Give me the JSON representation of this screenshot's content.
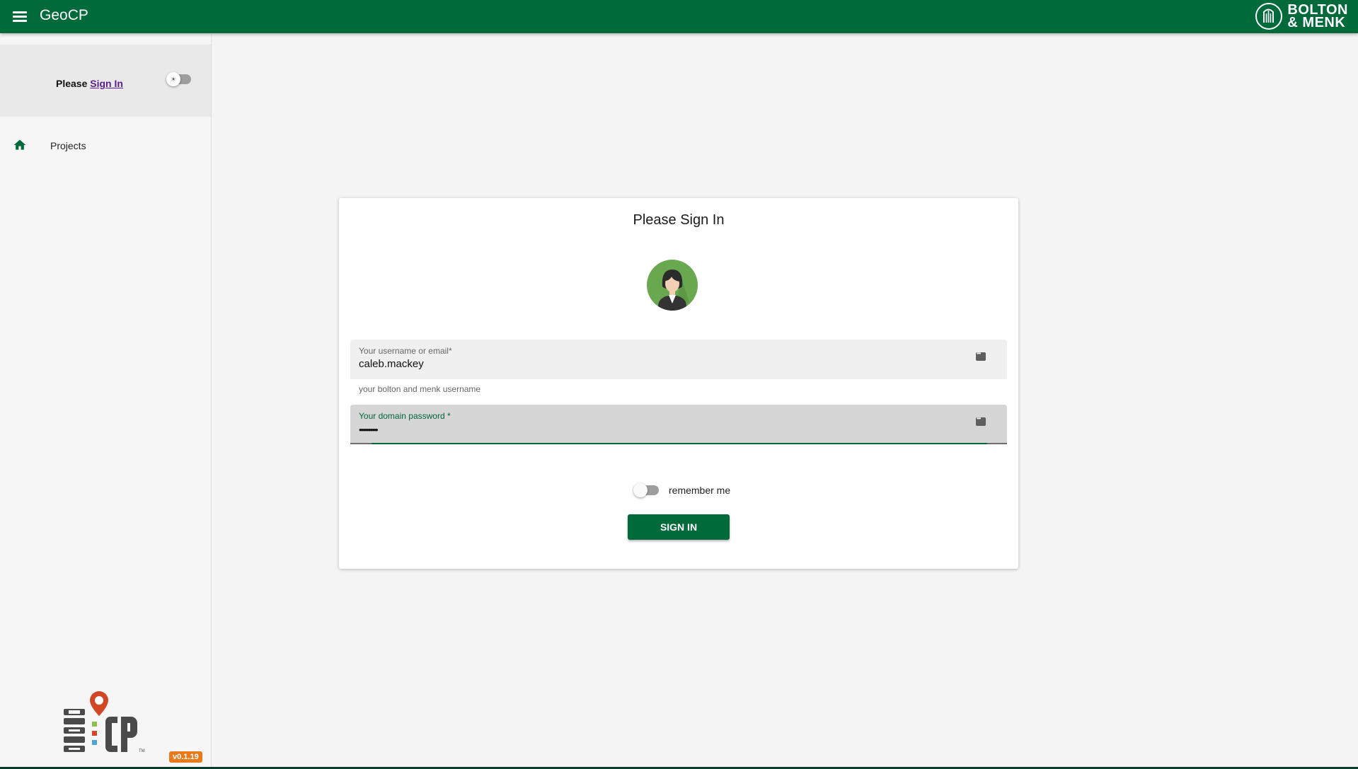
{
  "appbar": {
    "title": "GeoCP",
    "brand_line1": "BOLTON",
    "brand_line2": "& MENK"
  },
  "sidebar": {
    "please_text": "Please",
    "signin_link": "Sign In",
    "nav_items": [
      {
        "label": "Projects",
        "icon": "home-icon"
      }
    ],
    "version": "v0.1.19",
    "logo_text": "GEO CP"
  },
  "card": {
    "title": "Please Sign In",
    "username": {
      "label": "Your username or email*",
      "value": "caleb.mackey",
      "hint": "your bolton and menk username"
    },
    "password": {
      "label": "Your domain password *",
      "value": "••••••••••"
    },
    "remember_label": "remember me",
    "signin_button": "SIGN IN"
  },
  "colors": {
    "primary": "#006a3b",
    "accent_orange": "#e87a1e",
    "link": "#5a1e8c"
  }
}
